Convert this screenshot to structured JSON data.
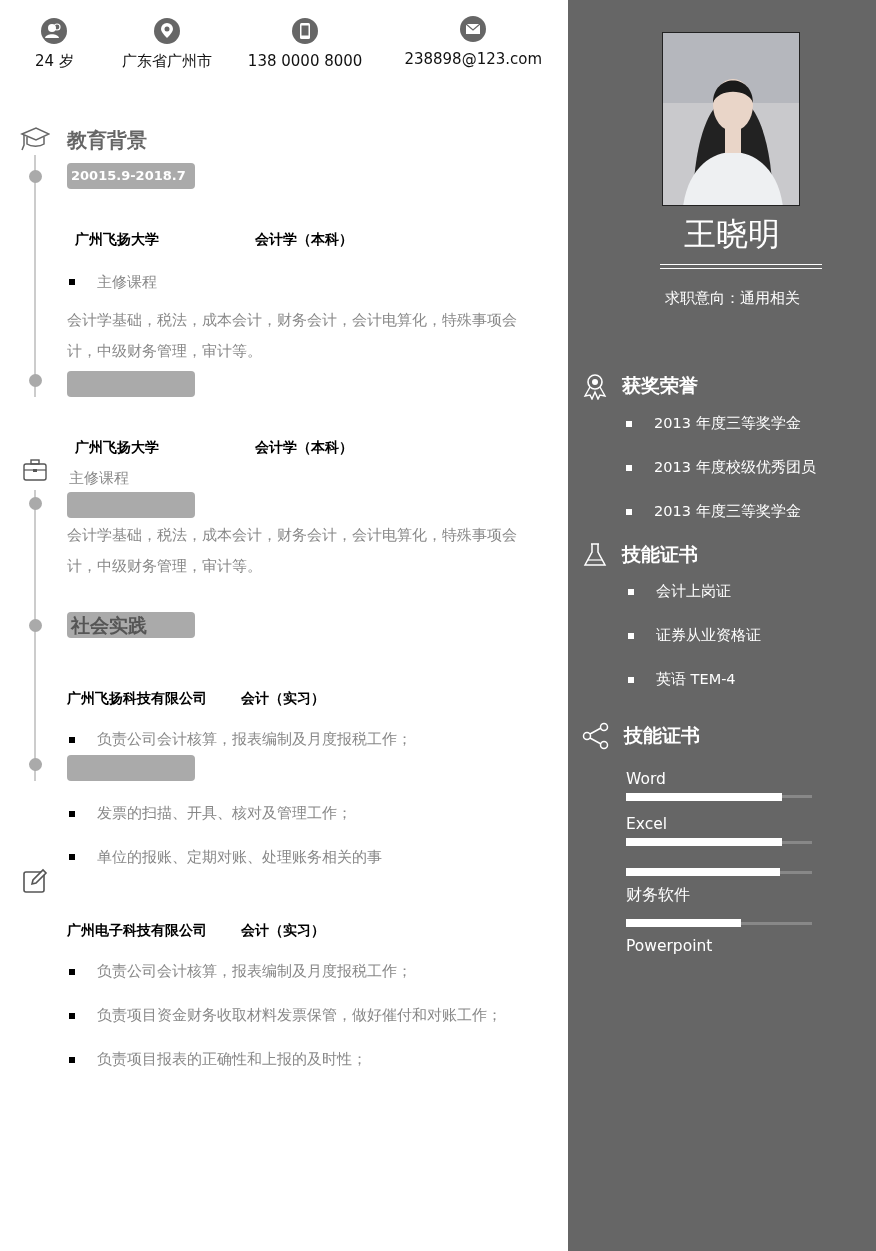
{
  "contacts": [
    {
      "kind": "age",
      "text": "24 岁"
    },
    {
      "kind": "location",
      "text": "广东省广州市"
    },
    {
      "kind": "phone",
      "text": "138 0000 8000"
    },
    {
      "kind": "email",
      "text": "238898@123.com"
    }
  ],
  "education": {
    "title": "教育背景",
    "date": "20015.9-2018.7",
    "entries": [
      {
        "school": "广州飞扬大学",
        "major": "会计学（本科）",
        "course": "主修课程",
        "course_bullet": true,
        "description": "会计学基础，税法，成本会计，财务会计，会计电算化，特殊事项会计，中级财务管理，审计等。"
      },
      {
        "school": "广州飞扬大学",
        "major": "会计学（本科）",
        "course": "主修课程",
        "course_bullet": false,
        "description": "会计学基础，税法，成本会计，财务会计，会计电算化，特殊事项会计，中级财务管理，审计等。"
      }
    ]
  },
  "practice": {
    "title": "社会实践",
    "entries": [
      {
        "company": "广州飞扬科技有限公司",
        "role": "会计（实习）",
        "duties": [
          "负责公司会计核算，报表编制及月度报税工作；",
          "发票的扫描、开具、核对及管理工作；",
          "单位的报账、定期对账、处理账务相关的事"
        ]
      },
      {
        "company": "广州电子科技有限公司",
        "role": "会计（实习）",
        "duties": [
          "负责公司会计核算，报表编制及月度报税工作；",
          "负责项目资金财务收取材料发票保管，做好催付和对账工作；",
          "负责项目报表的正确性和上报的及时性；"
        ]
      }
    ]
  },
  "profile": {
    "name": "王晓明",
    "intent": "求职意向：通用相关"
  },
  "honors": {
    "title": "获奖荣誉",
    "items": [
      "2013 年度三等奖学金",
      "2013 年度校级优秀团员",
      "2013 年度三等奖学金"
    ]
  },
  "certificates": {
    "title": "技能证书",
    "items": [
      "会计上岗证",
      "证券从业资格证",
      "英语 TEM-4"
    ]
  },
  "skills": {
    "title": "技能证书",
    "items": [
      {
        "name": "Word",
        "level": 0.84,
        "kind": "label-above"
      },
      {
        "name": "Excel",
        "level": 0.84,
        "kind": "label-above"
      },
      {
        "name": "财务软件",
        "level": 0.83,
        "kind": "label-below"
      },
      {
        "name": "Powerpoint",
        "level": 0.62,
        "kind": "label-below"
      }
    ]
  }
}
